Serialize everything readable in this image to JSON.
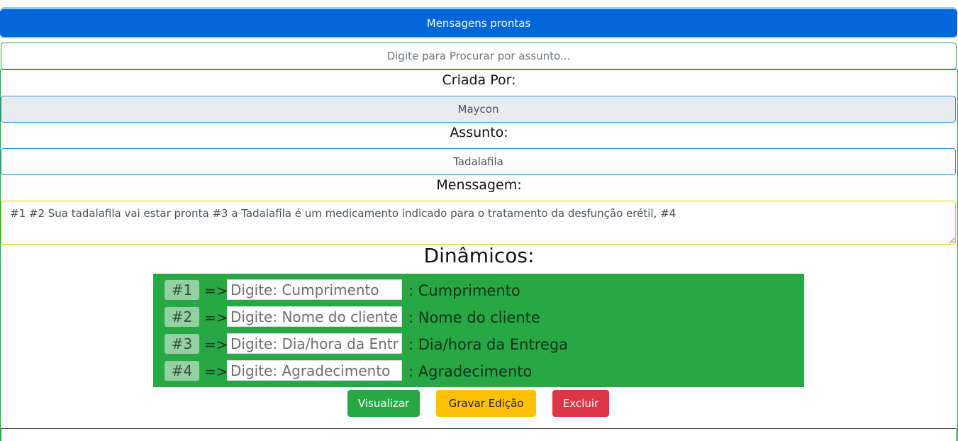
{
  "header": {
    "title": "Mensagens prontas"
  },
  "search": {
    "placeholder": "Digite para Procurar por assunto..."
  },
  "form": {
    "created_by_label": "Criada Por:",
    "created_by_value": "Maycon",
    "subject_label": "Assunto:",
    "subject_value": "Tadalafila",
    "message_label": "Menssagem:",
    "message_value": "#1 #2 Sua tadalafila vai estar pronta #3 a Tadalafila é um medicamento indicado para o tratamento da desfunção erétil, #4"
  },
  "dynamics": {
    "title": "Dinâmicos:",
    "arrow": "=>",
    "rows": [
      {
        "tag": "#1",
        "placeholder": "Digite: Cumprimento",
        "description": ": Cumprimento"
      },
      {
        "tag": "#2",
        "placeholder": "Digite: Nome do cliente",
        "description": ": Nome do cliente"
      },
      {
        "tag": "#3",
        "placeholder": "Digite: Dia/hora da Entrega",
        "description": ": Dia/hora da Entrega"
      },
      {
        "tag": "#4",
        "placeholder": "Digite: Agradecimento",
        "description": ": Agradecimento"
      }
    ]
  },
  "actions": {
    "view_label": "Visualizar",
    "save_label": "Gravar Edição",
    "delete_label": "Excluir"
  },
  "colors": {
    "primary": "#0066da",
    "success": "#28a745",
    "warning": "#ffc107",
    "danger": "#dc3545"
  }
}
